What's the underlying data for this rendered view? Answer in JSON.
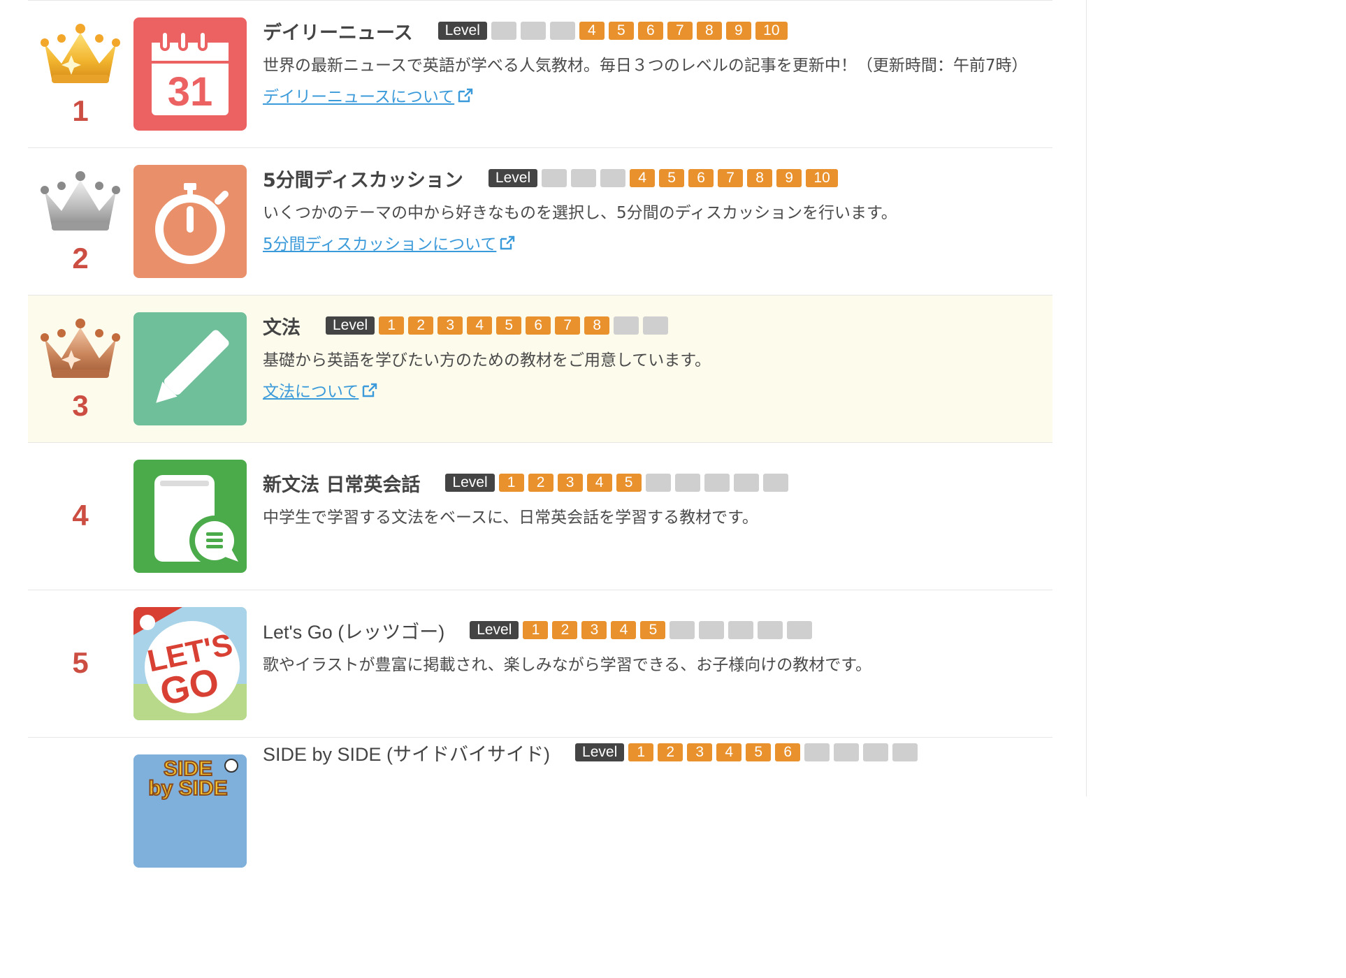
{
  "level_label": "Level",
  "levels": [
    "1",
    "2",
    "3",
    "4",
    "5",
    "6",
    "7",
    "8",
    "9",
    "10"
  ],
  "colors": {
    "rank": "#cc4e43",
    "level_on": "#e8912d",
    "level_off": "#cfcfcf",
    "link": "#3b9ad9",
    "highlight_row": "#fdfbec"
  },
  "items": [
    {
      "rank": "1",
      "crown": "gold-crown-icon",
      "icon": "calendar-icon",
      "icon_text": "31",
      "title": "デイリーニュース",
      "active_levels": [
        4,
        5,
        6,
        7,
        8,
        9,
        10
      ],
      "description": "世界の最新ニュースで英語が学べる人気教材。毎日３つのレベルの記事を更新中！（更新時間：午前7時）",
      "link": "デイリーニュースについて"
    },
    {
      "rank": "2",
      "crown": "silver-crown-icon",
      "icon": "stopwatch-icon",
      "title": "5分間ディスカッション",
      "active_levels": [
        4,
        5,
        6,
        7,
        8,
        9,
        10
      ],
      "description": "いくつかのテーマの中から好きなものを選択し、5分間のディスカッションを行います。",
      "link": "5分間ディスカッションについて"
    },
    {
      "rank": "3",
      "crown": "bronze-crown-icon",
      "icon": "pencil-icon",
      "title": "文法",
      "active_levels": [
        1,
        2,
        3,
        4,
        5,
        6,
        7,
        8
      ],
      "description": "基礎から英語を学びたい方のための教材をご用意しています。",
      "link": "文法について"
    },
    {
      "rank": "4",
      "icon": "book-chat-icon",
      "title": "新文法 日常英会話",
      "active_levels": [
        1,
        2,
        3,
        4,
        5
      ],
      "description": "中学生で学習する文法をベースに、日常英会話を学習する教材です。"
    },
    {
      "rank": "5",
      "icon": "lets-go-cover",
      "title": "Let's Go (レッツゴー)",
      "active_levels": [
        1,
        2,
        3,
        4,
        5
      ],
      "description": "歌やイラストが豊富に掲載され、楽しみながら学習できる、お子様向けの教材です。"
    },
    {
      "rank": "",
      "icon": "side-by-side-cover",
      "title": "SIDE by SIDE (サイドバイサイド)",
      "active_levels": [
        1,
        2,
        3,
        4,
        5,
        6
      ],
      "description": ""
    }
  ]
}
